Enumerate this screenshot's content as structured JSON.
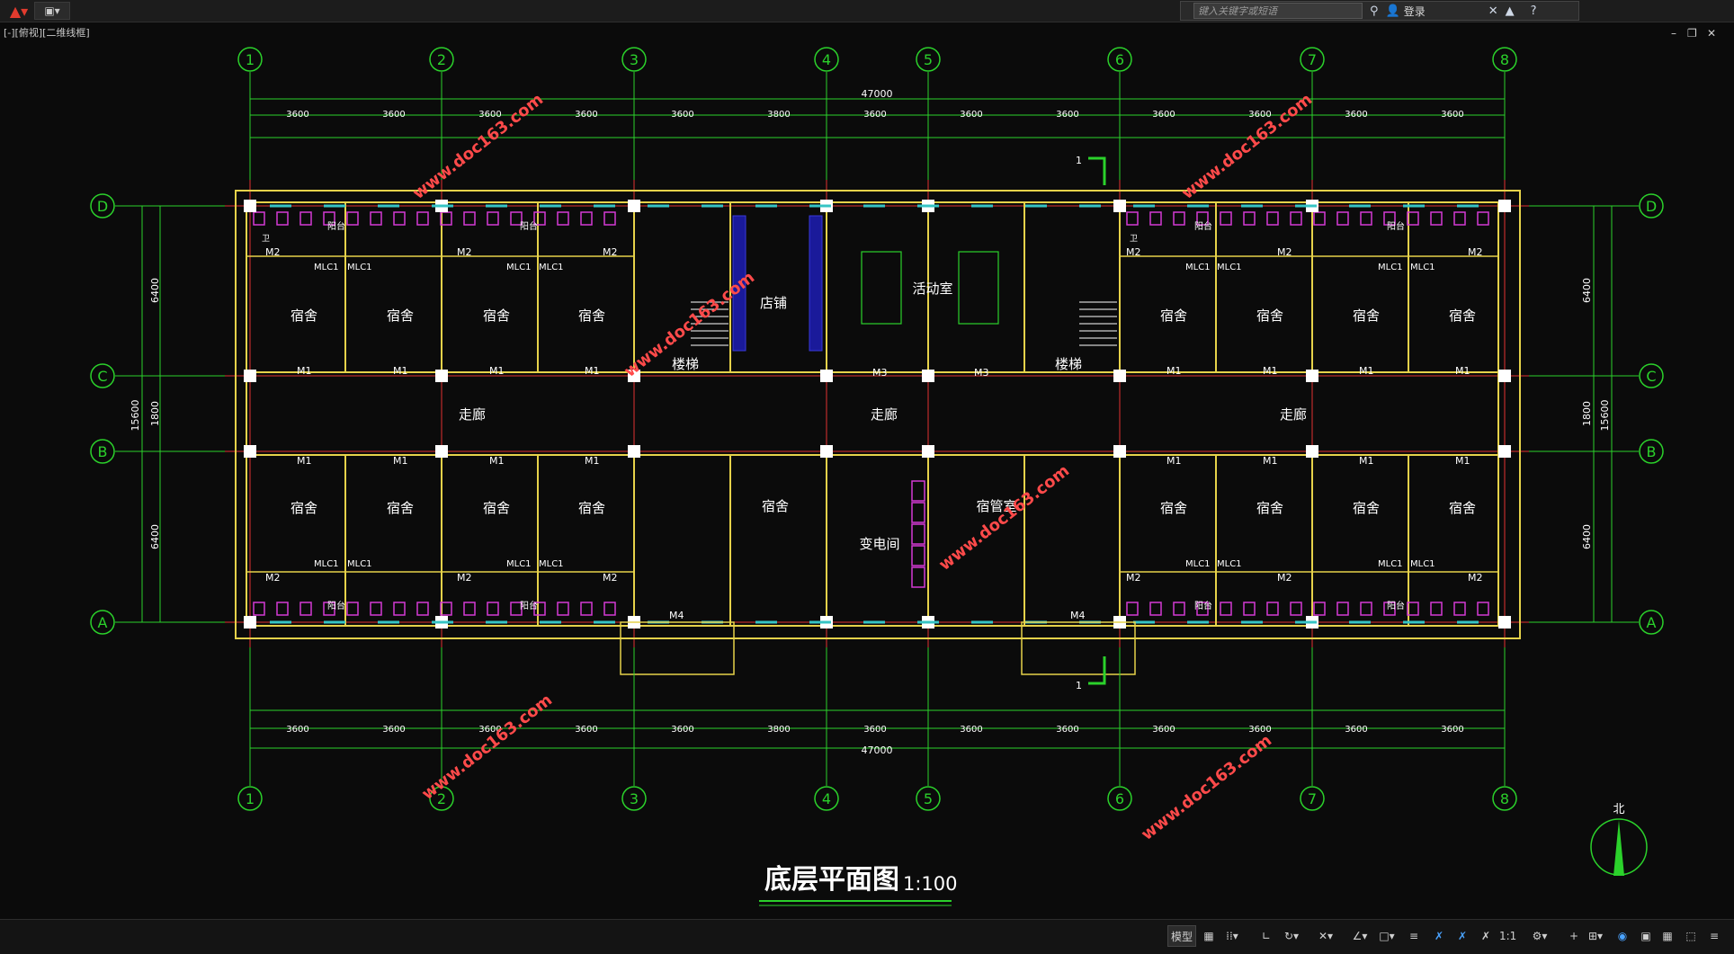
{
  "toolbar": {
    "search_placeholder": "键入关键字或短语",
    "login": "登录",
    "help": "?"
  },
  "viewport": {
    "label": "[-][俯视][二维线框]"
  },
  "drawing": {
    "title": "底层平面图",
    "scale": "1:100",
    "overall_dim": "47000",
    "col_labels": [
      "1",
      "2",
      "3",
      "4",
      "5",
      "6",
      "7",
      "8"
    ],
    "row_labels": [
      "D",
      "C",
      "B",
      "A"
    ],
    "span_dims": [
      "3600",
      "3600",
      "3600",
      "3600",
      "3800",
      "3600",
      "3600"
    ],
    "span_dims_full": [
      "3600",
      "3600",
      "3600",
      "3600",
      "3600",
      "3800",
      "3600",
      "3600",
      "3600",
      "3600",
      "3600",
      "3600",
      "3600"
    ],
    "left_dims": [
      "6400",
      "1800",
      "6400"
    ],
    "total_depth": "15600",
    "rooms": {
      "dorm": "宿舍",
      "shop": "店铺",
      "activity": "活动室",
      "stair": "楼梯",
      "corridor": "走廊",
      "dorm_mgr": "宿管室",
      "substation": "变电间",
      "balcony": "阳台",
      "toilet": "卫"
    },
    "doors": {
      "m1": "M1",
      "m2": "M2",
      "m3": "M3",
      "m4": "M4",
      "mlc1": "MLC1"
    },
    "watermark": "www.doc163.com",
    "north": "北",
    "section_mark": "1"
  },
  "status": {
    "model": "模型",
    "scale": "1:1"
  }
}
